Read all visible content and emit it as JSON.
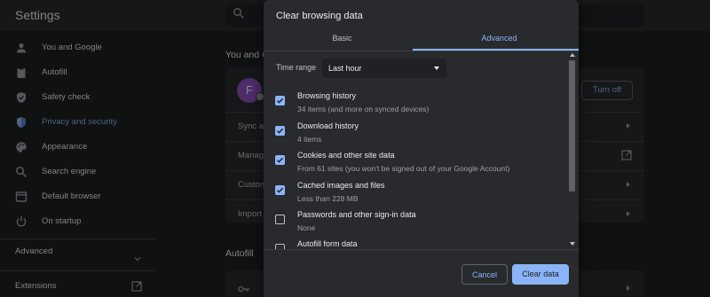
{
  "app": {
    "title": "Settings"
  },
  "sidebar": {
    "items": [
      {
        "label": "You and Google",
        "icon": "person-icon"
      },
      {
        "label": "Autofill",
        "icon": "clipboard-icon"
      },
      {
        "label": "Safety check",
        "icon": "shield-check-icon"
      },
      {
        "label": "Privacy and security",
        "icon": "shield-icon",
        "active": true
      },
      {
        "label": "Appearance",
        "icon": "palette-icon"
      },
      {
        "label": "Search engine",
        "icon": "search-icon"
      },
      {
        "label": "Default browser",
        "icon": "browser-icon"
      },
      {
        "label": "On startup",
        "icon": "power-icon"
      }
    ],
    "advanced_label": "Advanced",
    "extensions_label": "Extensions"
  },
  "main": {
    "you_and_google_title": "You and G",
    "avatar_initial": "F",
    "turn_off_label": "Turn off",
    "rows": [
      "Sync an",
      "Manag",
      "Custom",
      "Import"
    ],
    "autofill_title": "Autofill"
  },
  "dialog": {
    "title": "Clear browsing data",
    "tabs": {
      "basic": "Basic",
      "advanced": "Advanced"
    },
    "time_range_label": "Time range",
    "time_range_value": "Last hour",
    "options": [
      {
        "title": "Browsing history",
        "desc": "34 items (and more on synced devices)",
        "checked": true
      },
      {
        "title": "Download history",
        "desc": "4 items",
        "checked": true
      },
      {
        "title": "Cookies and other site data",
        "desc": "From 61 sites (you won't be signed out of your Google Account)",
        "checked": true
      },
      {
        "title": "Cached images and files",
        "desc": "Less than 228 MB",
        "checked": true
      },
      {
        "title": "Passwords and other sign-in data",
        "desc": "None",
        "checked": false
      },
      {
        "title": "Autofill form data",
        "desc": "",
        "checked": false
      }
    ],
    "cancel_label": "Cancel",
    "clear_label": "Clear data"
  },
  "colors": {
    "accent": "#8ab4f8",
    "background": "#1e1f20",
    "dialog": "#292a2d"
  }
}
